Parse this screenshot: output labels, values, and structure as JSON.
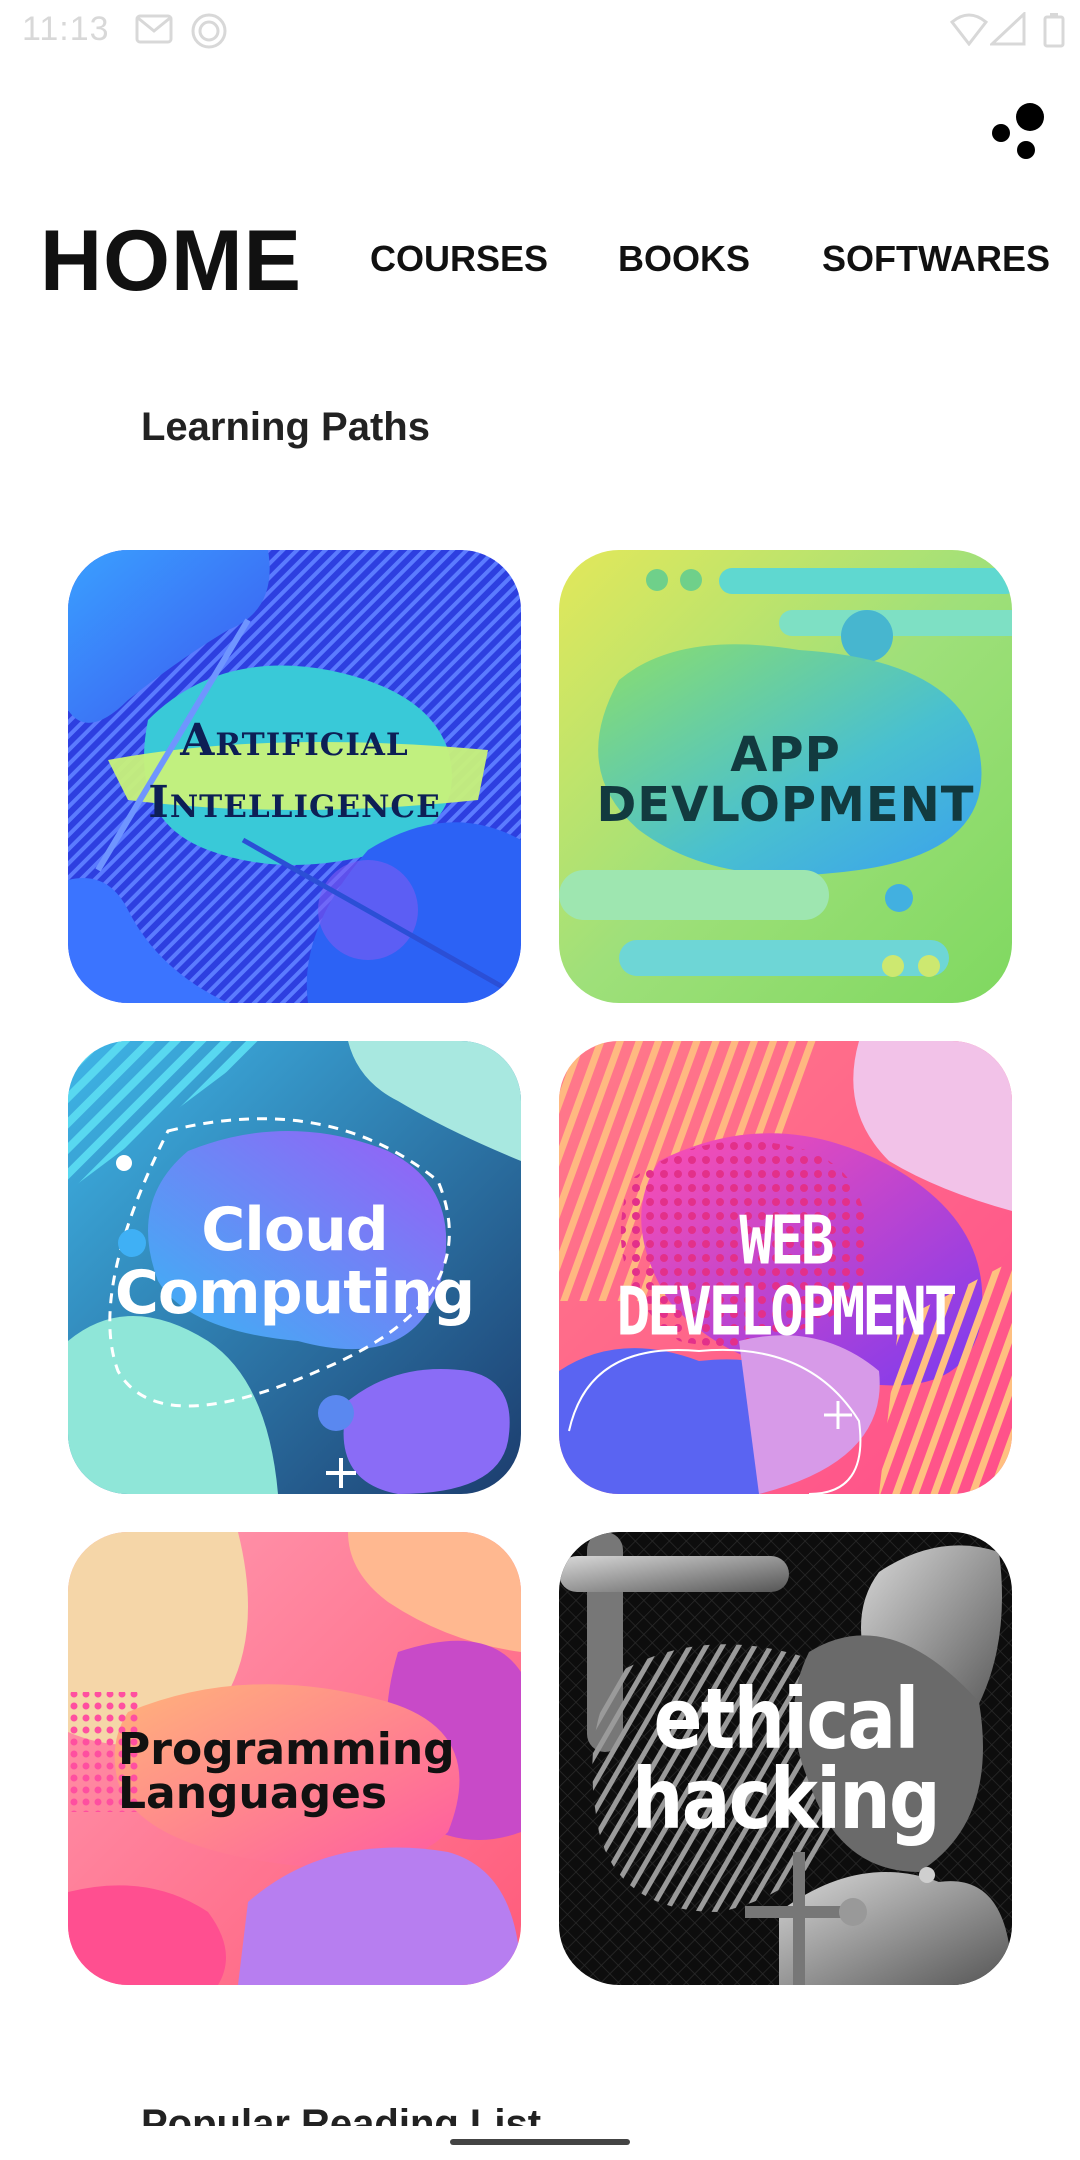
{
  "status_bar": {
    "time": "11:13",
    "icons": [
      "gmail-icon",
      "sync-icon",
      "wifi-icon",
      "signal-icon",
      "battery-icon"
    ]
  },
  "menu": {
    "icon": "dots-menu-icon"
  },
  "tabs": [
    {
      "label": "HOME",
      "active": true
    },
    {
      "label": "COURSES",
      "active": false
    },
    {
      "label": "BOOKS",
      "active": false
    },
    {
      "label": "SOFTWARES",
      "active": false
    }
  ],
  "sections": {
    "learning_paths": "Learning Paths",
    "popular_reading": "Popular Reading List"
  },
  "cards": [
    {
      "title_line1": "Artificial",
      "title_line2": "Intelligence",
      "colors": [
        "#2f5ce8",
        "#3fd0e0",
        "#b9f36a"
      ]
    },
    {
      "title_line1": "APP",
      "title_line2": "DEVLOPMENT",
      "colors": [
        "#d6e35a",
        "#62d7b0",
        "#39aee8"
      ]
    },
    {
      "title_line1": "Cloud",
      "title_line2": "Computing",
      "colors": [
        "#3a6fd8",
        "#8b5cf6",
        "#6fe0e0"
      ]
    },
    {
      "title_line1": "WEB",
      "title_line2": "DEVELOPMENT",
      "colors": [
        "#ff6f91",
        "#c43ad8",
        "#3a5cf0"
      ]
    },
    {
      "title_line1": "Programming",
      "title_line2": "Languages",
      "colors": [
        "#ff8fa0",
        "#ff4f9a",
        "#f5c9a0"
      ]
    },
    {
      "title_line1": "ethical",
      "title_line2": "hacking",
      "colors": [
        "#111111",
        "#555555",
        "#bbbbbb"
      ]
    }
  ]
}
